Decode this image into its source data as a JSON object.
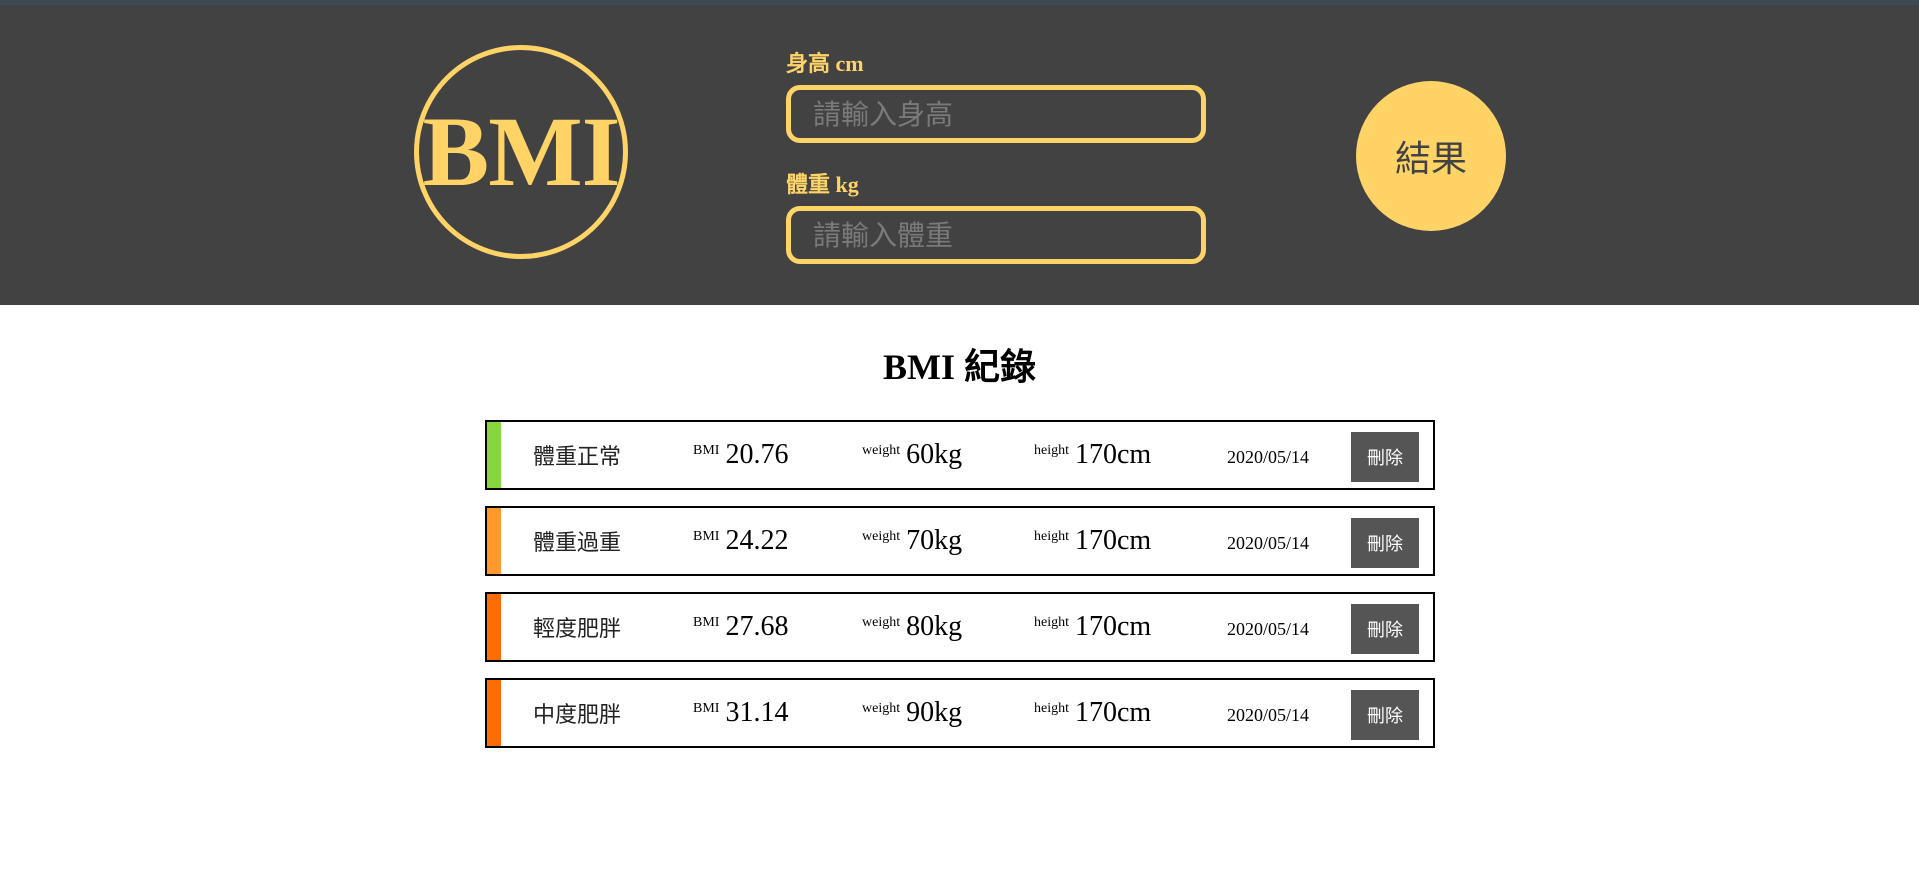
{
  "header": {
    "logo_text": "BMI",
    "height_label": "身高 cm",
    "height_placeholder": "請輸入身高",
    "weight_label": "體重 kg",
    "weight_placeholder": "請輸入體重",
    "result_label": "結果"
  },
  "records": {
    "title": "BMI 紀錄",
    "labels": {
      "bmi": "BMI",
      "weight": "weight",
      "height": "height",
      "delete": "刪除"
    },
    "items": [
      {
        "status": "體重正常",
        "bmi": "20.76",
        "weight": "60kg",
        "height": "170cm",
        "date": "2020/05/14",
        "color": "#86d73e"
      },
      {
        "status": "體重過重",
        "bmi": "24.22",
        "weight": "70kg",
        "height": "170cm",
        "date": "2020/05/14",
        "color": "#ff982d"
      },
      {
        "status": "輕度肥胖",
        "bmi": "27.68",
        "weight": "80kg",
        "height": "170cm",
        "date": "2020/05/14",
        "color": "#ff6c02"
      },
      {
        "status": "中度肥胖",
        "bmi": "31.14",
        "weight": "90kg",
        "height": "170cm",
        "date": "2020/05/14",
        "color": "#ff6c02"
      }
    ]
  },
  "colors": {
    "accent": "#ffd366",
    "header_bg": "#424242",
    "delete_bg": "#555555"
  }
}
